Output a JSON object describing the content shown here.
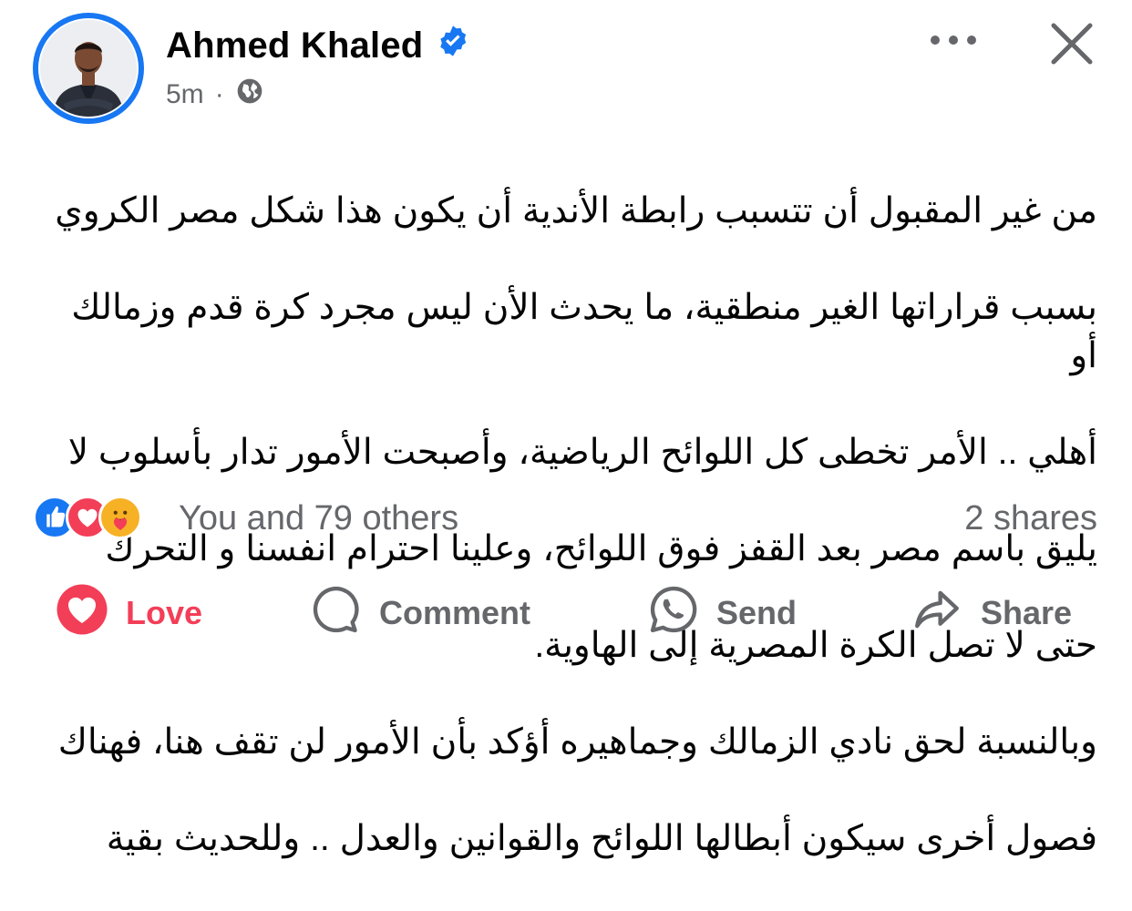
{
  "header": {
    "author_name": "Ahmed Khaled",
    "verified": true,
    "time_ago": "5m",
    "separator": "·",
    "privacy": "globe-icon"
  },
  "post": {
    "text_lines": [
      "من غير المقبول أن تتسبب رابطة الأندية أن يكون هذا شكل مصر الكروي",
      "بسبب قراراتها الغير منطقية، ما يحدث الأن ليس مجرد كرة قدم وزمالك أو",
      "أهلي .. الأمر تخطى كل اللوائح الرياضية، وأصبحت الأمور تدار بأسلوب لا",
      "يليق باسم مصر بعد القفز فوق اللوائح، وعلينا احترام انفسنا و التحرك",
      "حتى لا تصل الكرة المصرية إلى الهاوية.",
      "وبالنسبة لحق نادي الزمالك وجماهيره أؤكد بأن الأمور لن تقف هنا، فهناك",
      "فصول أخرى سيكون أبطالها اللوائح والقوانين والعدل .. وللحديث بقية"
    ]
  },
  "stats": {
    "reaction_icons": [
      "like-icon",
      "love-icon",
      "care-icon"
    ],
    "reactions_text": "You and 79 others",
    "shares_text": "2 shares"
  },
  "actions": {
    "love": "Love",
    "comment": "Comment",
    "send": "Send",
    "share": "Share"
  },
  "colors": {
    "accent": "#1877f2",
    "love": "#f33e58",
    "muted": "#65676b"
  }
}
